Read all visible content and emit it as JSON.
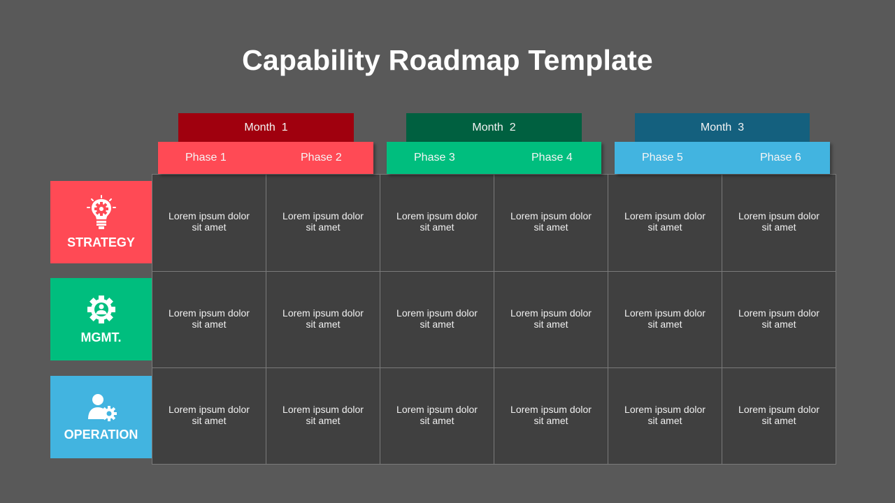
{
  "title": "Capability Roadmap Template",
  "colors": {
    "background": "#595959",
    "grid_fill": "#404040",
    "red_dark": "#a0000e",
    "red": "#ff4a55",
    "green_dark": "#006040",
    "green": "#00be7e",
    "blue_dark": "#14607e",
    "blue": "#42b4e0"
  },
  "months": [
    {
      "label": "Month  1",
      "color": "#a0000e"
    },
    {
      "label": "Month  2",
      "color": "#006040"
    },
    {
      "label": "Month  3",
      "color": "#14607e"
    }
  ],
  "phases": [
    {
      "label": "Phase 1"
    },
    {
      "label": "Phase 2"
    },
    {
      "label": "Phase 3"
    },
    {
      "label": "Phase 4"
    },
    {
      "label": "Phase 5"
    },
    {
      "label": "Phase 6"
    }
  ],
  "categories": [
    {
      "label": "STRATEGY",
      "icon": "lightbulb-gear-icon",
      "color": "#ff4a55"
    },
    {
      "label": "MGMT.",
      "icon": "gear-person-icon",
      "color": "#00be7e"
    },
    {
      "label": "OPERATION",
      "icon": "user-gear-icon",
      "color": "#42b4e0"
    }
  ],
  "rows": [
    {
      "cells": [
        "Lorem ipsum dolor\nsit amet",
        "Lorem ipsum dolor\nsit amet",
        "Lorem ipsum dolor\nsit amet",
        "Lorem ipsum dolor\nsit amet",
        "Lorem ipsum dolor\nsit amet",
        "Lorem ipsum dolor\nsit amet"
      ]
    },
    {
      "cells": [
        "Lorem ipsum dolor\nsit amet",
        "Lorem ipsum dolor\nsit amet",
        "Lorem ipsum dolor\nsit amet",
        "Lorem ipsum dolor\nsit amet",
        "Lorem ipsum dolor\nsit amet",
        "Lorem ipsum dolor\nsit amet"
      ]
    },
    {
      "cells": [
        "Lorem ipsum dolor\nsit amet",
        "Lorem ipsum dolor\nsit amet",
        "Lorem ipsum dolor\nsit amet",
        "Lorem ipsum dolor\nsit amet",
        "Lorem ipsum dolor\nsit amet",
        "Lorem ipsum dolor\nsit amet"
      ]
    }
  ]
}
